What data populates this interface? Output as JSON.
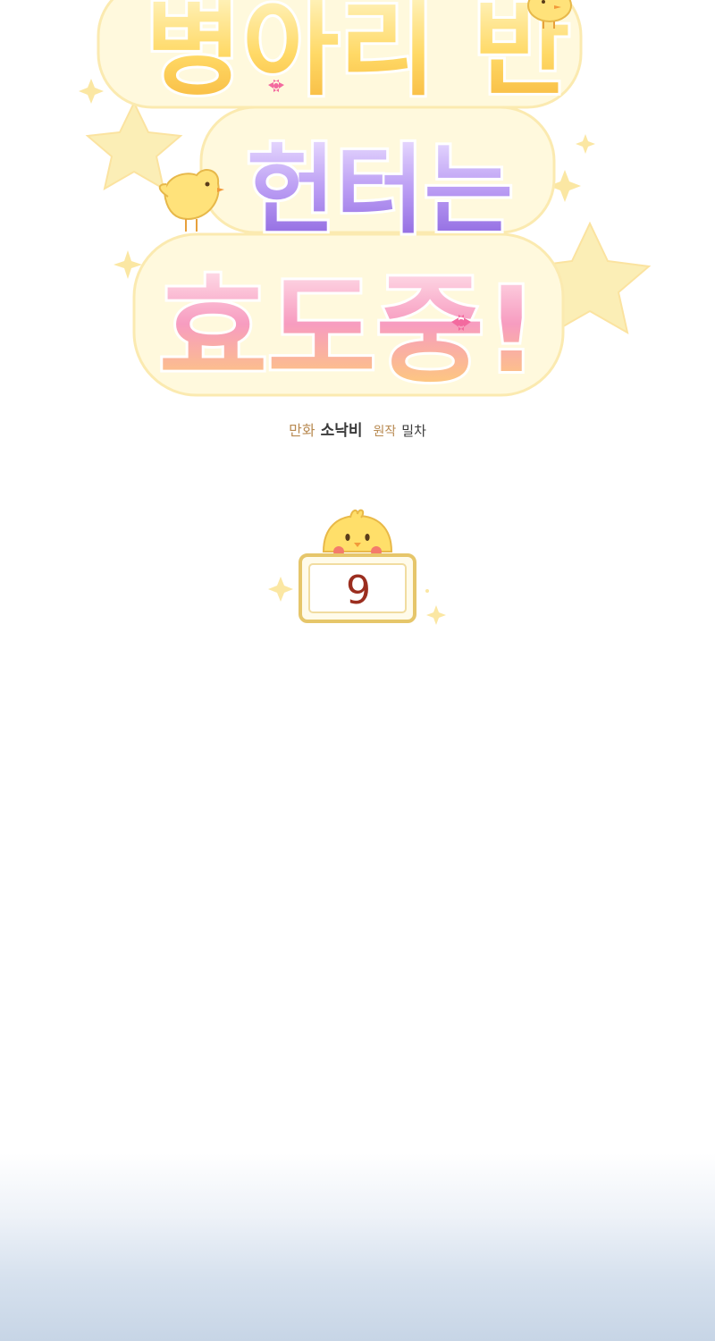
{
  "title": {
    "line1": "병아리 반",
    "line2": "헌터는",
    "line3": "효도중!"
  },
  "credits": {
    "art_label": "만화",
    "art_name": "소낙비",
    "story_label": "원작",
    "story_name": "밀차"
  },
  "episode": {
    "number": "9"
  },
  "colors": {
    "title_yellow": "#f7c94a",
    "title_purple": "#9a78e6",
    "title_pink": "#f27aa6",
    "credit_label": "#b88a52",
    "episode_number": "#9b2e1f",
    "star": "#fbe9a8"
  }
}
